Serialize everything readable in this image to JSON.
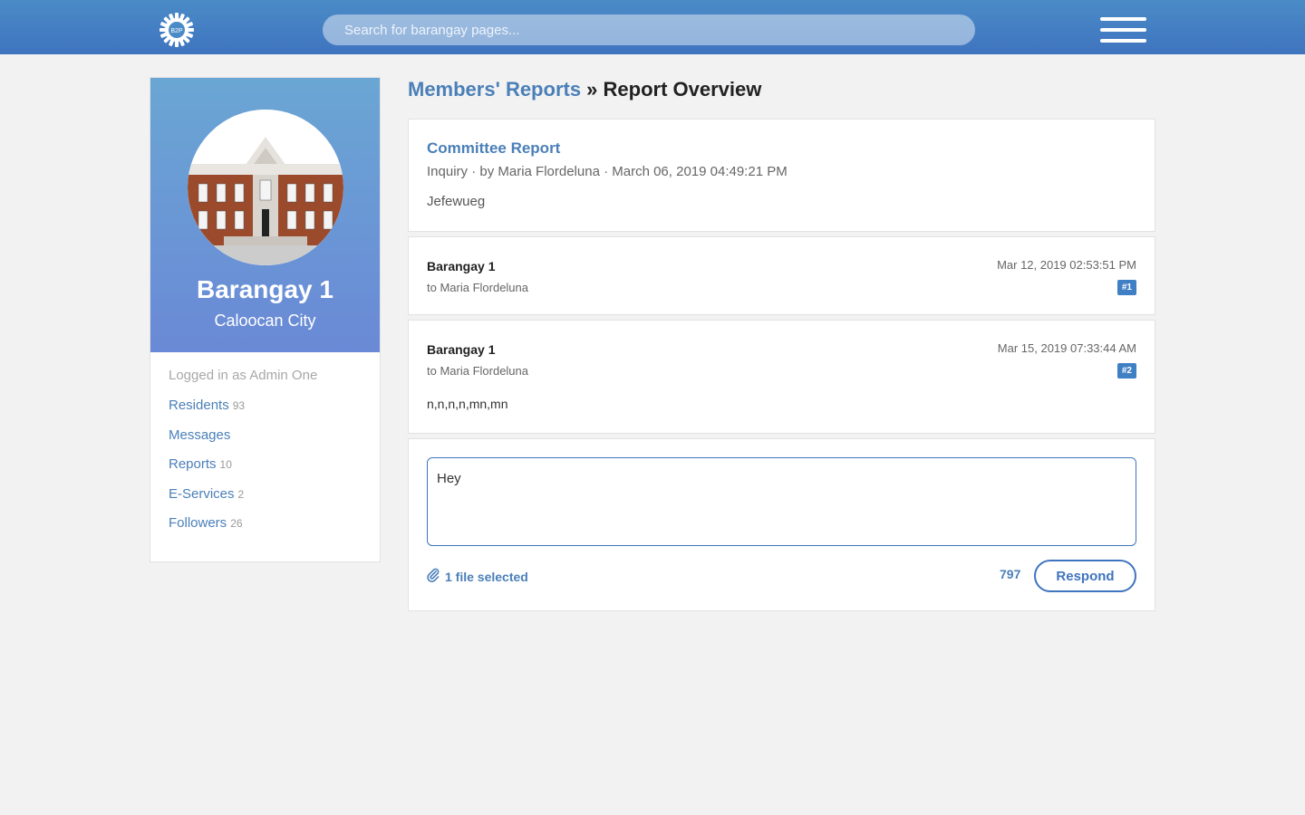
{
  "header": {
    "logo_text": "B2P",
    "search_placeholder": "Search for barangay pages..."
  },
  "profile": {
    "name": "Barangay 1",
    "city": "Caloocan City"
  },
  "sidebar": {
    "logged_in": "Logged in as Admin One",
    "items": [
      {
        "label": "Residents",
        "count": "93"
      },
      {
        "label": "Messages",
        "count": ""
      },
      {
        "label": "Reports",
        "count": "10"
      },
      {
        "label": "E-Services",
        "count": "2"
      },
      {
        "label": "Followers",
        "count": "26"
      }
    ]
  },
  "breadcrumb": {
    "parent": "Members' Reports",
    "separator": " » ",
    "current": "Report Overview"
  },
  "report": {
    "title": "Committee Report",
    "meta": "Inquiry · by Maria Flordeluna · March 06, 2019 04:49:21 PM",
    "body": "Jefewueg"
  },
  "messages": [
    {
      "from": "Barangay 1",
      "to": "to Maria Flordeluna",
      "date": "Mar 12, 2019 02:53:51 PM",
      "badge": "#1",
      "body": ""
    },
    {
      "from": "Barangay 1",
      "to": "to Maria Flordeluna",
      "date": "Mar 15, 2019 07:33:44 AM",
      "badge": "#2",
      "body": "n,n,n,n,mn,mn"
    }
  ],
  "reply": {
    "value": "Hey",
    "attachment": "1 file selected",
    "char_count": "797",
    "button": "Respond"
  }
}
